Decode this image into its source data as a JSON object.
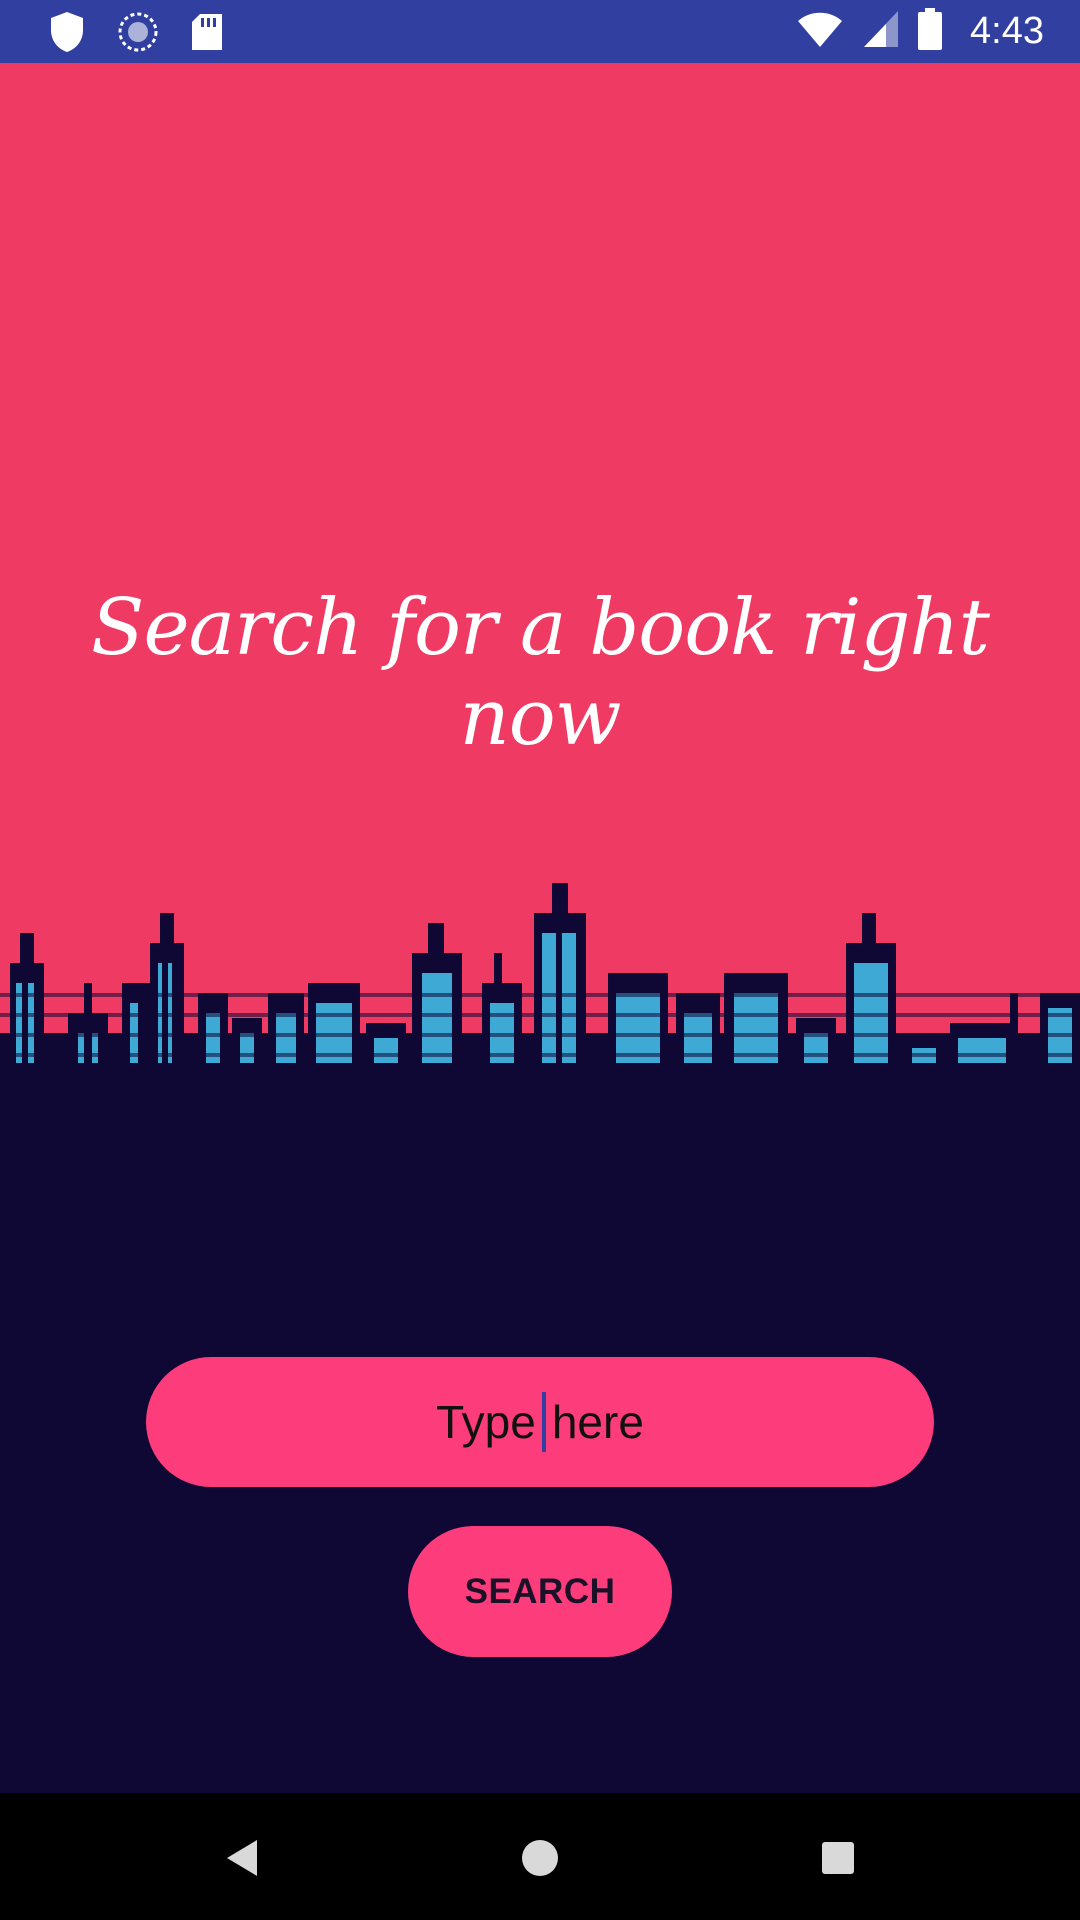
{
  "status_bar": {
    "time": "4:43",
    "left_icons": [
      "shield-icon",
      "sync-icon",
      "sd-card-icon"
    ],
    "right_icons": [
      "wifi-icon",
      "signal-icon",
      "battery-icon"
    ],
    "background": "#3140a0"
  },
  "hero": {
    "title": "Search for a book right now",
    "background": "#ef3a63",
    "skyline_colors": {
      "buildings": "#0f0835",
      "windows": "#3fa9d6"
    }
  },
  "search": {
    "input_value": "Type here",
    "input_before_cursor": "Type",
    "input_after_cursor": "here",
    "button_label": "SEARCH",
    "accent": "#fd3c7b"
  },
  "nav_bar": {
    "buttons": [
      "back-icon",
      "home-icon",
      "recents-icon"
    ]
  },
  "theme": {
    "background_dark": "#0f0835"
  }
}
